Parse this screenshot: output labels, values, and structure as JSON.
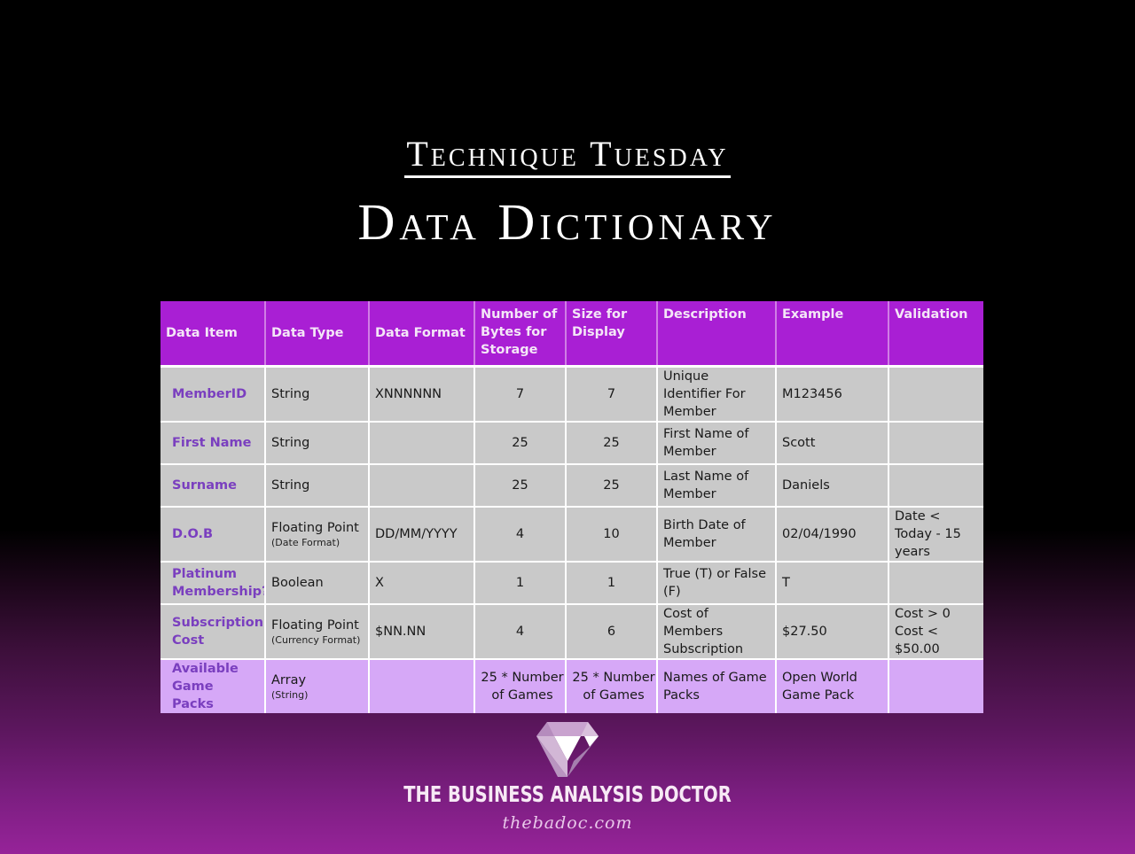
{
  "header": {
    "subtitle": "Technique Tuesday",
    "title": "Data Dictionary"
  },
  "table": {
    "columns": [
      "Data Item",
      "Data Type",
      "Data Format",
      "Number of Bytes for Storage",
      "Size for Display",
      "Description",
      "Example",
      "Validation"
    ],
    "rows": [
      {
        "item": "MemberID",
        "type": "String",
        "type_note": "",
        "format": "XNNNNNN",
        "bytes": "7",
        "display": "7",
        "description": "Unique Identifier For Member",
        "example": "M123456",
        "validation": ""
      },
      {
        "item": "First Name",
        "type": "String",
        "type_note": "",
        "format": "",
        "bytes": "25",
        "display": "25",
        "description": "First Name of Member",
        "example": "Scott",
        "validation": ""
      },
      {
        "item": "Surname",
        "type": "String",
        "type_note": "",
        "format": "",
        "bytes": "25",
        "display": "25",
        "description": "Last Name of Member",
        "example": "Daniels",
        "validation": ""
      },
      {
        "item": "D.O.B",
        "type": "Floating Point",
        "type_note": "(Date Format)",
        "format": "DD/MM/YYYY",
        "bytes": "4",
        "display": "10",
        "description": "Birth Date of Member",
        "example": "02/04/1990",
        "validation": "Date < Today - 15 years"
      },
      {
        "item": "Platinum Membership?",
        "type": "Boolean",
        "type_note": "",
        "format": "X",
        "bytes": "1",
        "display": "1",
        "description": "True (T) or False (F)",
        "example": "T",
        "validation": ""
      },
      {
        "item": "Subscription Cost",
        "type": "Floating Point",
        "type_note": "(Currency Format)",
        "format": "$NN.NN",
        "bytes": "4",
        "display": "6",
        "description": "Cost of Members Subscription",
        "example": "$27.50",
        "validation": "Cost > 0 Cost < $50.00"
      },
      {
        "item": "Available Game Packs",
        "type": "Array",
        "type_note": "(String)",
        "format": "",
        "bytes": "25 * Number of Games",
        "display": "25 * Number of Games",
        "description": "Names of Game Packs",
        "example": "Open World Game Pack",
        "validation": ""
      }
    ]
  },
  "footer": {
    "logo_icon": "diamond-logo-icon",
    "brand": "THE BUSINESS ANALYSIS DOCTOR",
    "website": "thebadoc.com"
  },
  "colors": {
    "header_bg": "#a91fd4",
    "row_bg": "#c9c9c9",
    "highlight_row_bg": "#d6a8f7",
    "item_text": "#7a3fbf"
  }
}
